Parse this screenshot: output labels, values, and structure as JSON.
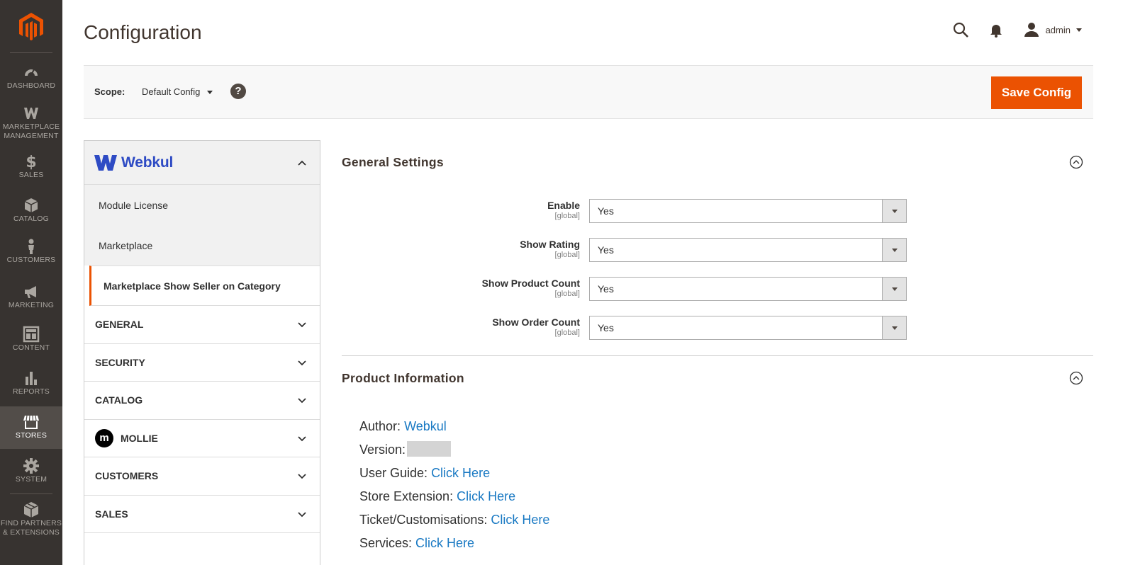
{
  "app": {
    "brand_color": "#eb5202",
    "sidebar_bg": "#373330"
  },
  "nav": {
    "items": [
      {
        "label": "DASHBOARD",
        "icon": "dashboard-icon"
      },
      {
        "label": "MARKETPLACE MANAGEMENT",
        "icon": "webkul-w-icon"
      },
      {
        "label": "SALES",
        "icon": "dollar-icon"
      },
      {
        "label": "CATALOG",
        "icon": "box-icon"
      },
      {
        "label": "CUSTOMERS",
        "icon": "person-icon"
      },
      {
        "label": "MARKETING",
        "icon": "megaphone-icon"
      },
      {
        "label": "CONTENT",
        "icon": "layout-icon"
      },
      {
        "label": "REPORTS",
        "icon": "bar-chart-icon"
      },
      {
        "label": "STORES",
        "icon": "store-icon",
        "active": true
      },
      {
        "label": "SYSTEM",
        "icon": "gear-icon"
      },
      {
        "label": "FIND PARTNERS & EXTENSIONS",
        "icon": "cube-icon"
      }
    ]
  },
  "header": {
    "title": "Configuration",
    "user": "admin"
  },
  "scope": {
    "label": "Scope:",
    "value": "Default Config",
    "help": "?",
    "save_label": "Save Config"
  },
  "tabs": {
    "vendor": "Webkul",
    "sub_items": [
      "Module License",
      "Marketplace",
      "Marketplace Show Seller on Category"
    ],
    "active_sub": "Marketplace Show Seller on Category",
    "sections": [
      "GENERAL",
      "SECURITY",
      "CATALOG",
      "MOLLIE",
      "CUSTOMERS",
      "SALES"
    ],
    "mollie_badge": "m"
  },
  "general_settings": {
    "title": "General Settings",
    "fields": [
      {
        "label": "Enable",
        "scope": "[global]",
        "value": "Yes"
      },
      {
        "label": "Show Rating",
        "scope": "[global]",
        "value": "Yes"
      },
      {
        "label": "Show Product Count",
        "scope": "[global]",
        "value": "Yes"
      },
      {
        "label": "Show Order Count",
        "scope": "[global]",
        "value": "Yes"
      }
    ]
  },
  "product_information": {
    "title": "Product Information",
    "author_label": "Author:",
    "author_link": "Webkul",
    "version_label": "Version:",
    "user_guide_label": "User Guide:",
    "store_extension_label": "Store Extension:",
    "ticket_label": "Ticket/Customisations:",
    "services_label": "Services:",
    "link_text": "Click Here"
  }
}
